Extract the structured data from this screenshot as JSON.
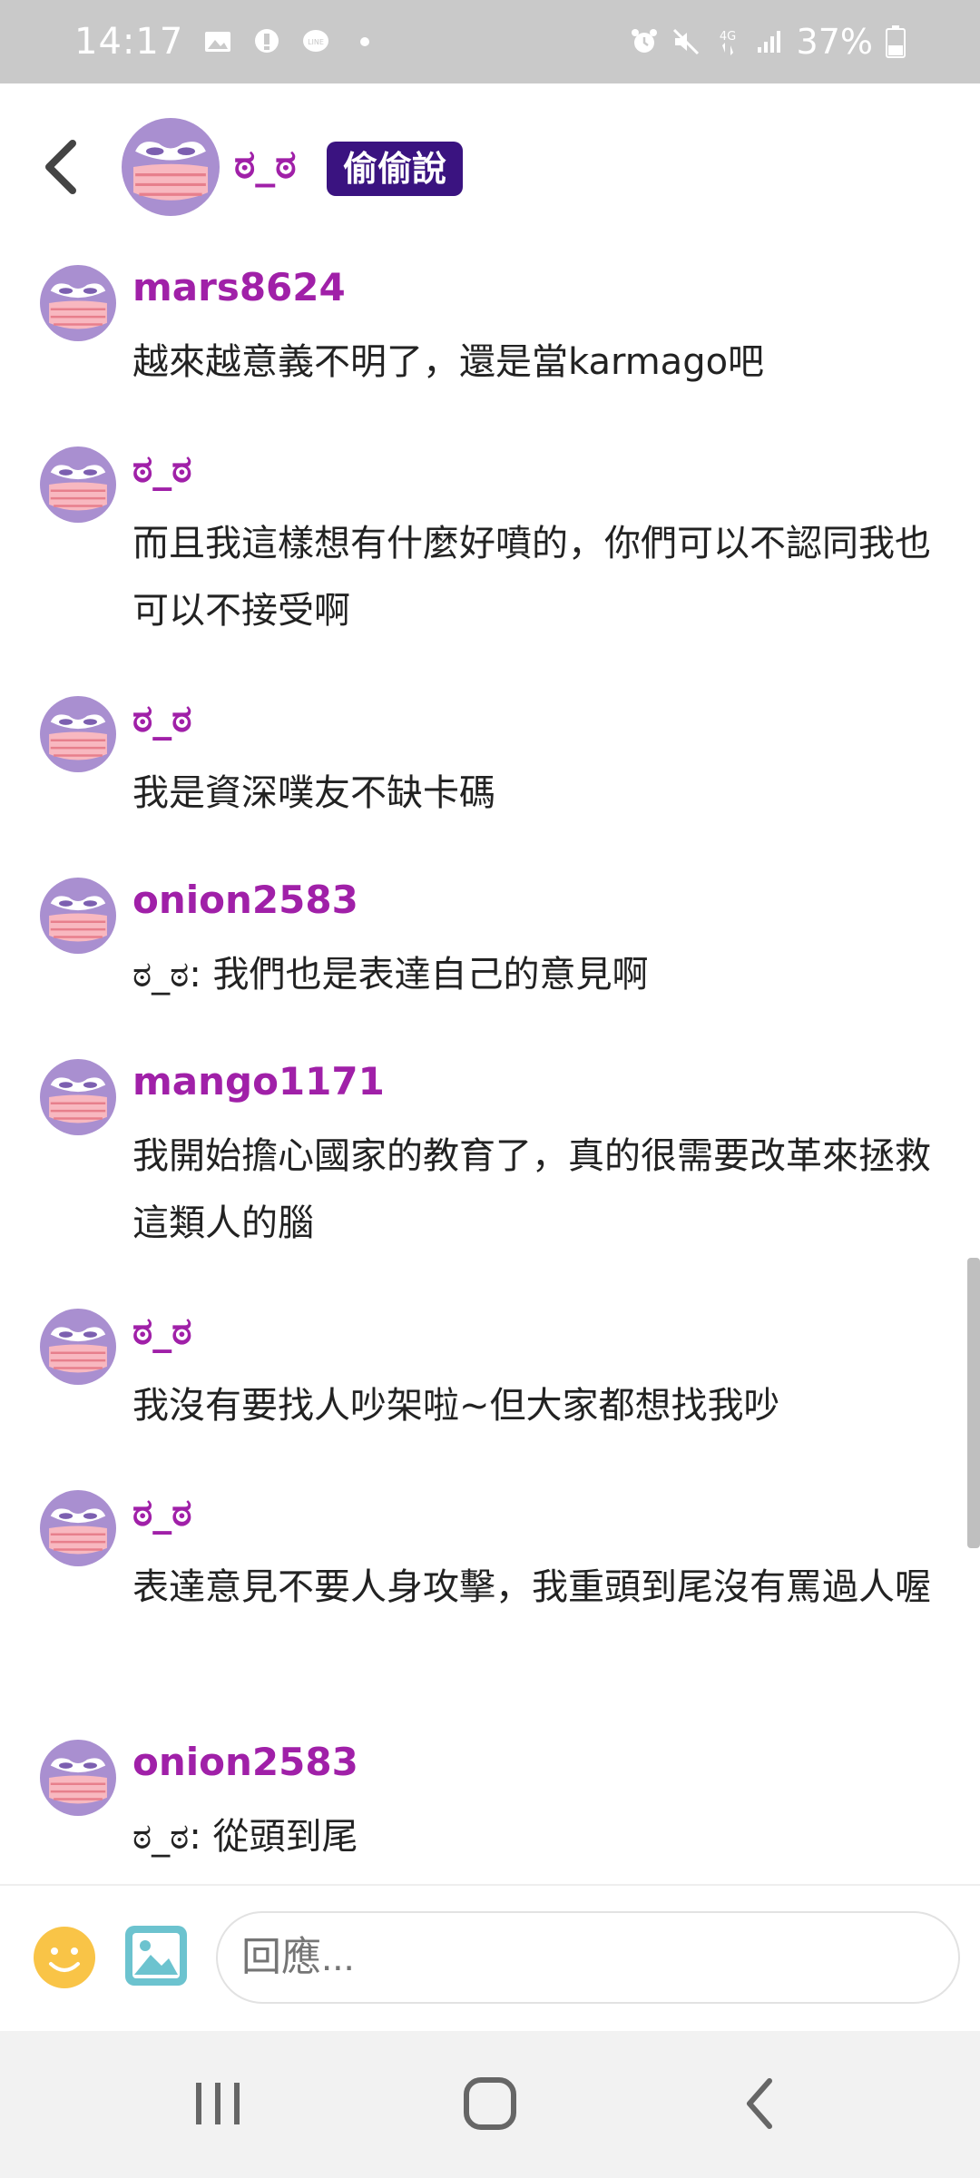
{
  "status_bar": {
    "time": "14:17",
    "icons_left": [
      "gallery-icon",
      "message-icon",
      "line-icon",
      "dot-icon"
    ],
    "icons_right": [
      "alarm-icon",
      "mute-icon",
      "4g-icon",
      "signal-icon",
      "battery-icon"
    ],
    "network": "4G",
    "battery": "37%"
  },
  "header": {
    "name": "ಠ_ಠ",
    "badge": "偷偷說"
  },
  "messages": [
    {
      "user": "mars8624",
      "text": "越來越意義不明了，還是當karmago吧"
    },
    {
      "user": "ಠ_ಠ",
      "text": "而且我這樣想有什麼好噴的，你們可以不認同我也可以不接受啊"
    },
    {
      "user": "ಠ_ಠ",
      "text": "我是資深噗友不缺卡碼"
    },
    {
      "user": "onion2583",
      "text": "ಠ_ಠ: 我們也是表達自己的意見啊"
    },
    {
      "user": "mango1171",
      "text": "我開始擔心國家的教育了，真的很需要改革來拯救這類人的腦"
    },
    {
      "user": "ಠ_ಠ",
      "text": "我沒有要找人吵架啦~但大家都想找我吵"
    },
    {
      "user": "ಠ_ಠ",
      "text": "表達意見不要人身攻擊，我重頭到尾沒有罵過人喔"
    },
    {
      "user": "onion2583",
      "text": "ಠ_ಠ: 從頭到尾"
    }
  ],
  "input": {
    "placeholder": "回應..."
  },
  "colors": {
    "username": "#a020a8",
    "badge_bg": "#3a1380",
    "status_bar": "#c9c9c9",
    "avatar": "#a98fd0"
  }
}
